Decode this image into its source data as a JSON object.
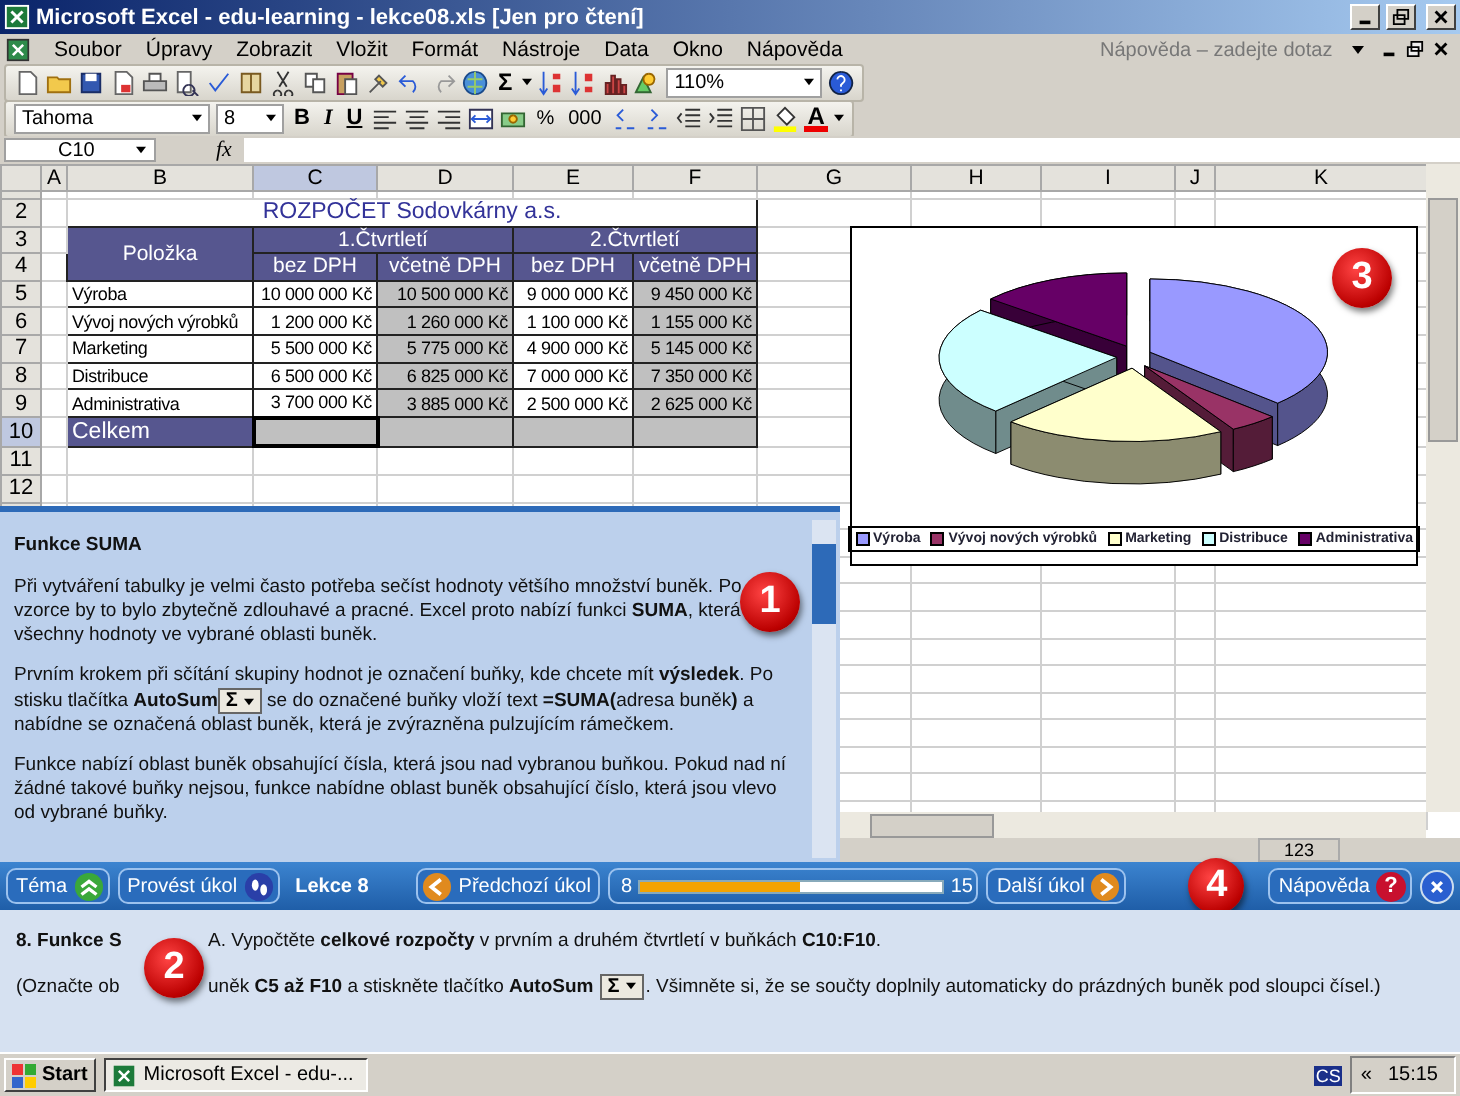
{
  "window": {
    "title": "Microsoft Excel - edu-learning - lekce08.xls  [Jen pro čtení]"
  },
  "menu": [
    "Soubor",
    "Úpravy",
    "Zobrazit",
    "Vložit",
    "Formát",
    "Nástroje",
    "Data",
    "Okno",
    "Nápověda"
  ],
  "help_search": {
    "placeholder": "Nápověda – zadejte dotaz"
  },
  "standard_toolbar": {
    "sum": "Σ",
    "zoom": "110%"
  },
  "formatting_toolbar": {
    "font": "Tahoma",
    "size": "8",
    "styles": [
      "B",
      "I",
      "U"
    ],
    "number_formats": [
      "%",
      "000"
    ],
    "font_color": "A"
  },
  "formula_bar": {
    "name_box": "C10",
    "fx": "fx"
  },
  "columns": [
    {
      "label": "A",
      "selected": false
    },
    {
      "label": "B",
      "selected": false
    },
    {
      "label": "C",
      "selected": true
    },
    {
      "label": "D",
      "selected": false
    },
    {
      "label": "E",
      "selected": false
    },
    {
      "label": "F",
      "selected": false
    },
    {
      "label": "G",
      "selected": false
    },
    {
      "label": "H",
      "selected": false
    },
    {
      "label": "I",
      "selected": false
    },
    {
      "label": "J",
      "selected": false
    },
    {
      "label": "K",
      "selected": false
    }
  ],
  "row_headers": [
    {
      "label": "2",
      "selected": false
    },
    {
      "label": "3",
      "selected": false
    },
    {
      "label": "4",
      "selected": false
    },
    {
      "label": "5",
      "selected": false
    },
    {
      "label": "6",
      "selected": false
    },
    {
      "label": "7",
      "selected": false
    },
    {
      "label": "8",
      "selected": false
    },
    {
      "label": "9",
      "selected": false
    },
    {
      "label": "10",
      "selected": true
    },
    {
      "label": "11",
      "selected": false
    },
    {
      "label": "12",
      "selected": false
    }
  ],
  "sheet": {
    "title": "ROZPOČET Sodovkárny a.s.",
    "item_header": "Položka",
    "quarters": [
      "1.Čtvrtletí",
      "2.Čtvrtletí"
    ],
    "subheaders": [
      "bez DPH",
      "včetně DPH",
      "bez DPH",
      "včetně DPH"
    ],
    "rows": [
      {
        "label": "Výroba",
        "values": [
          "10 000 000 Kč",
          "10 500 000 Kč",
          "9 000 000 Kč",
          "9 450 000 Kč"
        ]
      },
      {
        "label": "Vývoj nových výrobků",
        "values": [
          "1 200 000 Kč",
          "1 260 000 Kč",
          "1 100 000 Kč",
          "1 155 000 Kč"
        ]
      },
      {
        "label": "Marketing",
        "values": [
          "5 500 000 Kč",
          "5 775 000 Kč",
          "4 900 000 Kč",
          "5 145 000 Kč"
        ]
      },
      {
        "label": "Distribuce",
        "values": [
          "6 500 000 Kč",
          "6 825 000 Kč",
          "7 000 000 Kč",
          "7 350 000 Kč"
        ]
      },
      {
        "label": "Administrativa",
        "values": [
          "3 700 000 Kč",
          "3 885 000 Kč",
          "2 500 000 Kč",
          "2 625 000 Kč"
        ]
      }
    ],
    "total_label": "Celkem"
  },
  "chart": {
    "badge": "3",
    "legend": [
      {
        "label": "Výroba",
        "color": "#9999ff"
      },
      {
        "label": "Vývoj nových výrobků",
        "color": "#993366"
      },
      {
        "label": "Marketing",
        "color": "#ffffcc"
      },
      {
        "label": "Distribuce",
        "color": "#ccffff"
      },
      {
        "label": "Administrativa",
        "color": "#660066"
      }
    ]
  },
  "status_bar": {
    "indicator": "123"
  },
  "help_pane": {
    "badge": "1",
    "title": "Funkce SUMA",
    "paragraphs": [
      {
        "text": "Při vytváření tabulky je velmi často potřeba sečíst hodnoty většího množství buněk. Po vzorce by to bylo zbytečně zdlouhavé a pracné. Excel proto nabízí funkci **SUMA**, která všechny hodnoty ve vybrané oblasti buněk."
      },
      {
        "text": "Prvním krokem při sčítání skupiny hodnot je označení buňky, kde chcete mít **výsledek**. Po stisku tlačítka **AutoSum**",
        "button": "Σ",
        "after": "se do označené buňky vloží text **=SUMA(**adresa buněk**)** a nabídne se označená oblast buněk, která je zvýrazněna pulzujícím rámečkem."
      },
      {
        "text": "Funkce nabízí oblast buněk obsahující čísla, která jsou nad vybranou buňkou. Pokud nad ní žádné takové buňky nejsou, funkce nabídne oblast buněk obsahující číslo, která jsou vlevo od vybrané buňky."
      }
    ]
  },
  "nav": {
    "buttons": [
      {
        "label": "Téma",
        "kind": "topic"
      },
      {
        "label": "Provést úkol",
        "kind": "do-task"
      }
    ],
    "lesson": "Lekce 8",
    "prev": "Předchozí úkol",
    "progress": {
      "start": "8",
      "end": "15",
      "level": 0.53
    },
    "next": "Další úkol",
    "badge": "4",
    "help": "Nápověda",
    "help_glyph": "?"
  },
  "task": {
    "badge": "2",
    "title": "8. Funkce S",
    "line1": "A. Vypočtěte **celkové rozpočty** v prvním a druhém čtvrtletí v buňkách **C10:F10**.",
    "line2_start": "(Označte ob",
    "line2_before": "uněk **C5 až F10** a stiskněte tlačítko **AutoSum**",
    "button": "Σ",
    "line2_after": ". Všimněte si, že se součty doplnily automaticky do prázdných buněk pod sloupci čísel.)"
  },
  "taskbar": {
    "start": "Start",
    "tasks": [
      {
        "label": "Microsoft Excel - edu-...",
        "selected": true
      }
    ],
    "language": "CS",
    "tray_toggle": "«",
    "clock": "15:15"
  }
}
